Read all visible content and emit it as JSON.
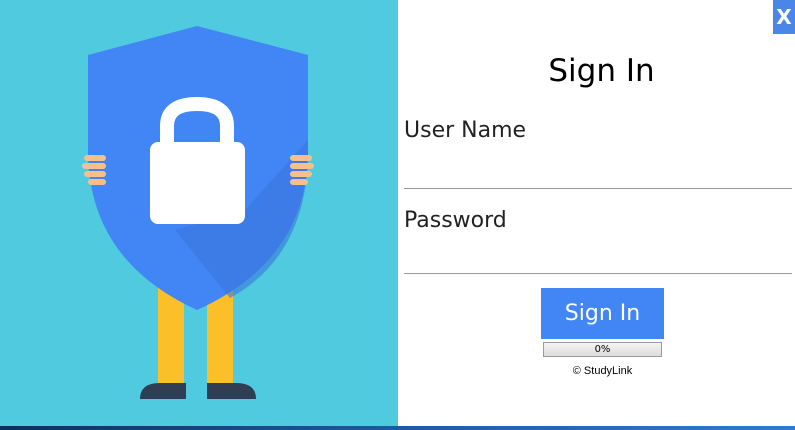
{
  "window": {
    "close_label": "X"
  },
  "illustration": {
    "icon": "shield-lock-illustration",
    "colors": {
      "background": "#4fcadf",
      "shield": "#4285f4",
      "lock": "#ffffff",
      "legs": "#fbbf2a",
      "shoes": "#2f3e55",
      "hands": "#f6c08e"
    }
  },
  "form": {
    "title": "Sign In",
    "username_label": "User Name",
    "username_value": "",
    "password_label": "Password",
    "password_value": "",
    "submit_label": "Sign In",
    "progress_percent": 0,
    "progress_text": "0%",
    "copyright": "© StudyLink"
  },
  "colors": {
    "accent": "#4285f4",
    "close_button": "#4a86e8"
  }
}
